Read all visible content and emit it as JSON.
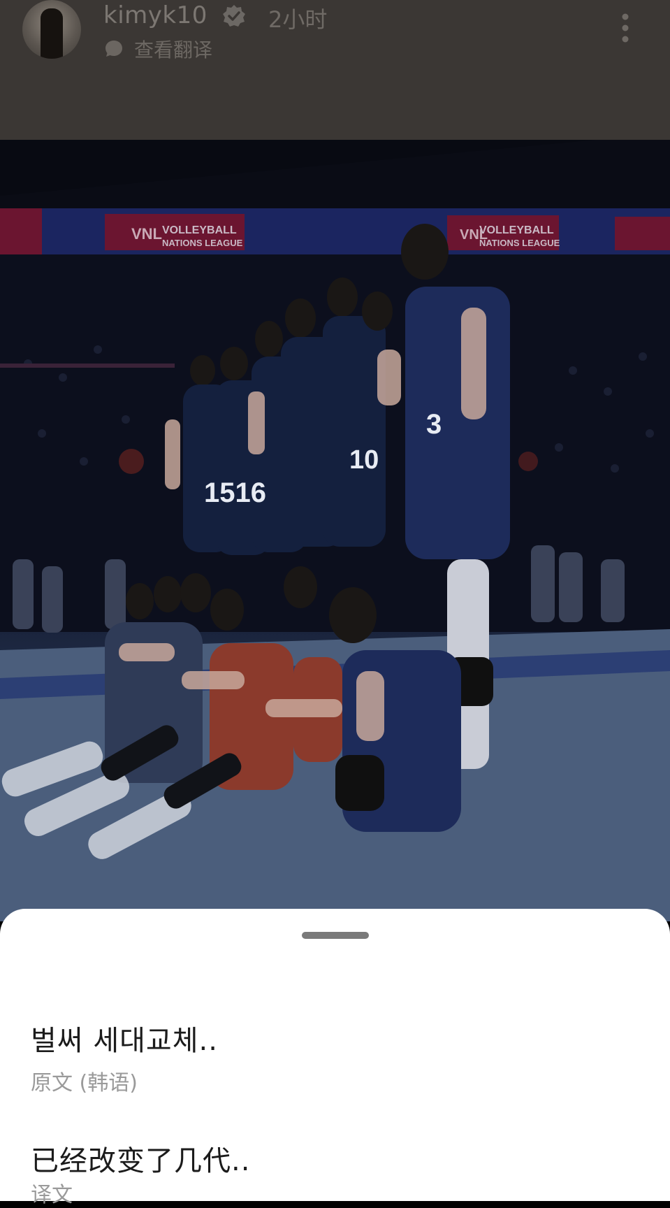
{
  "post": {
    "username": "kimyk10",
    "time_ago": "2小时",
    "translate_label": "查看翻译",
    "photo_banner_left": "VOLLEYBALL NATIONS LEAGUE",
    "photo_banner_right": "VOLLEYBALL NATIONS LEAGUE",
    "photo_logo": "VNL",
    "jersey_numbers": [
      "1516",
      "10",
      "3"
    ]
  },
  "sheet": {
    "original_text": "벌써 세대교체..",
    "original_label": "原文 (韩语)",
    "translated_text": "已经改变了几代..",
    "translated_label": "译文"
  },
  "colors": {
    "header_bg": "#3b3734",
    "sheet_bg": "#ffffff",
    "banner_red": "#6b1530",
    "banner_blue": "#1b2560"
  },
  "icons": {
    "verified": "verified-badge-icon",
    "translate": "speech-bubble-icon",
    "more": "vertical-dots-icon"
  }
}
